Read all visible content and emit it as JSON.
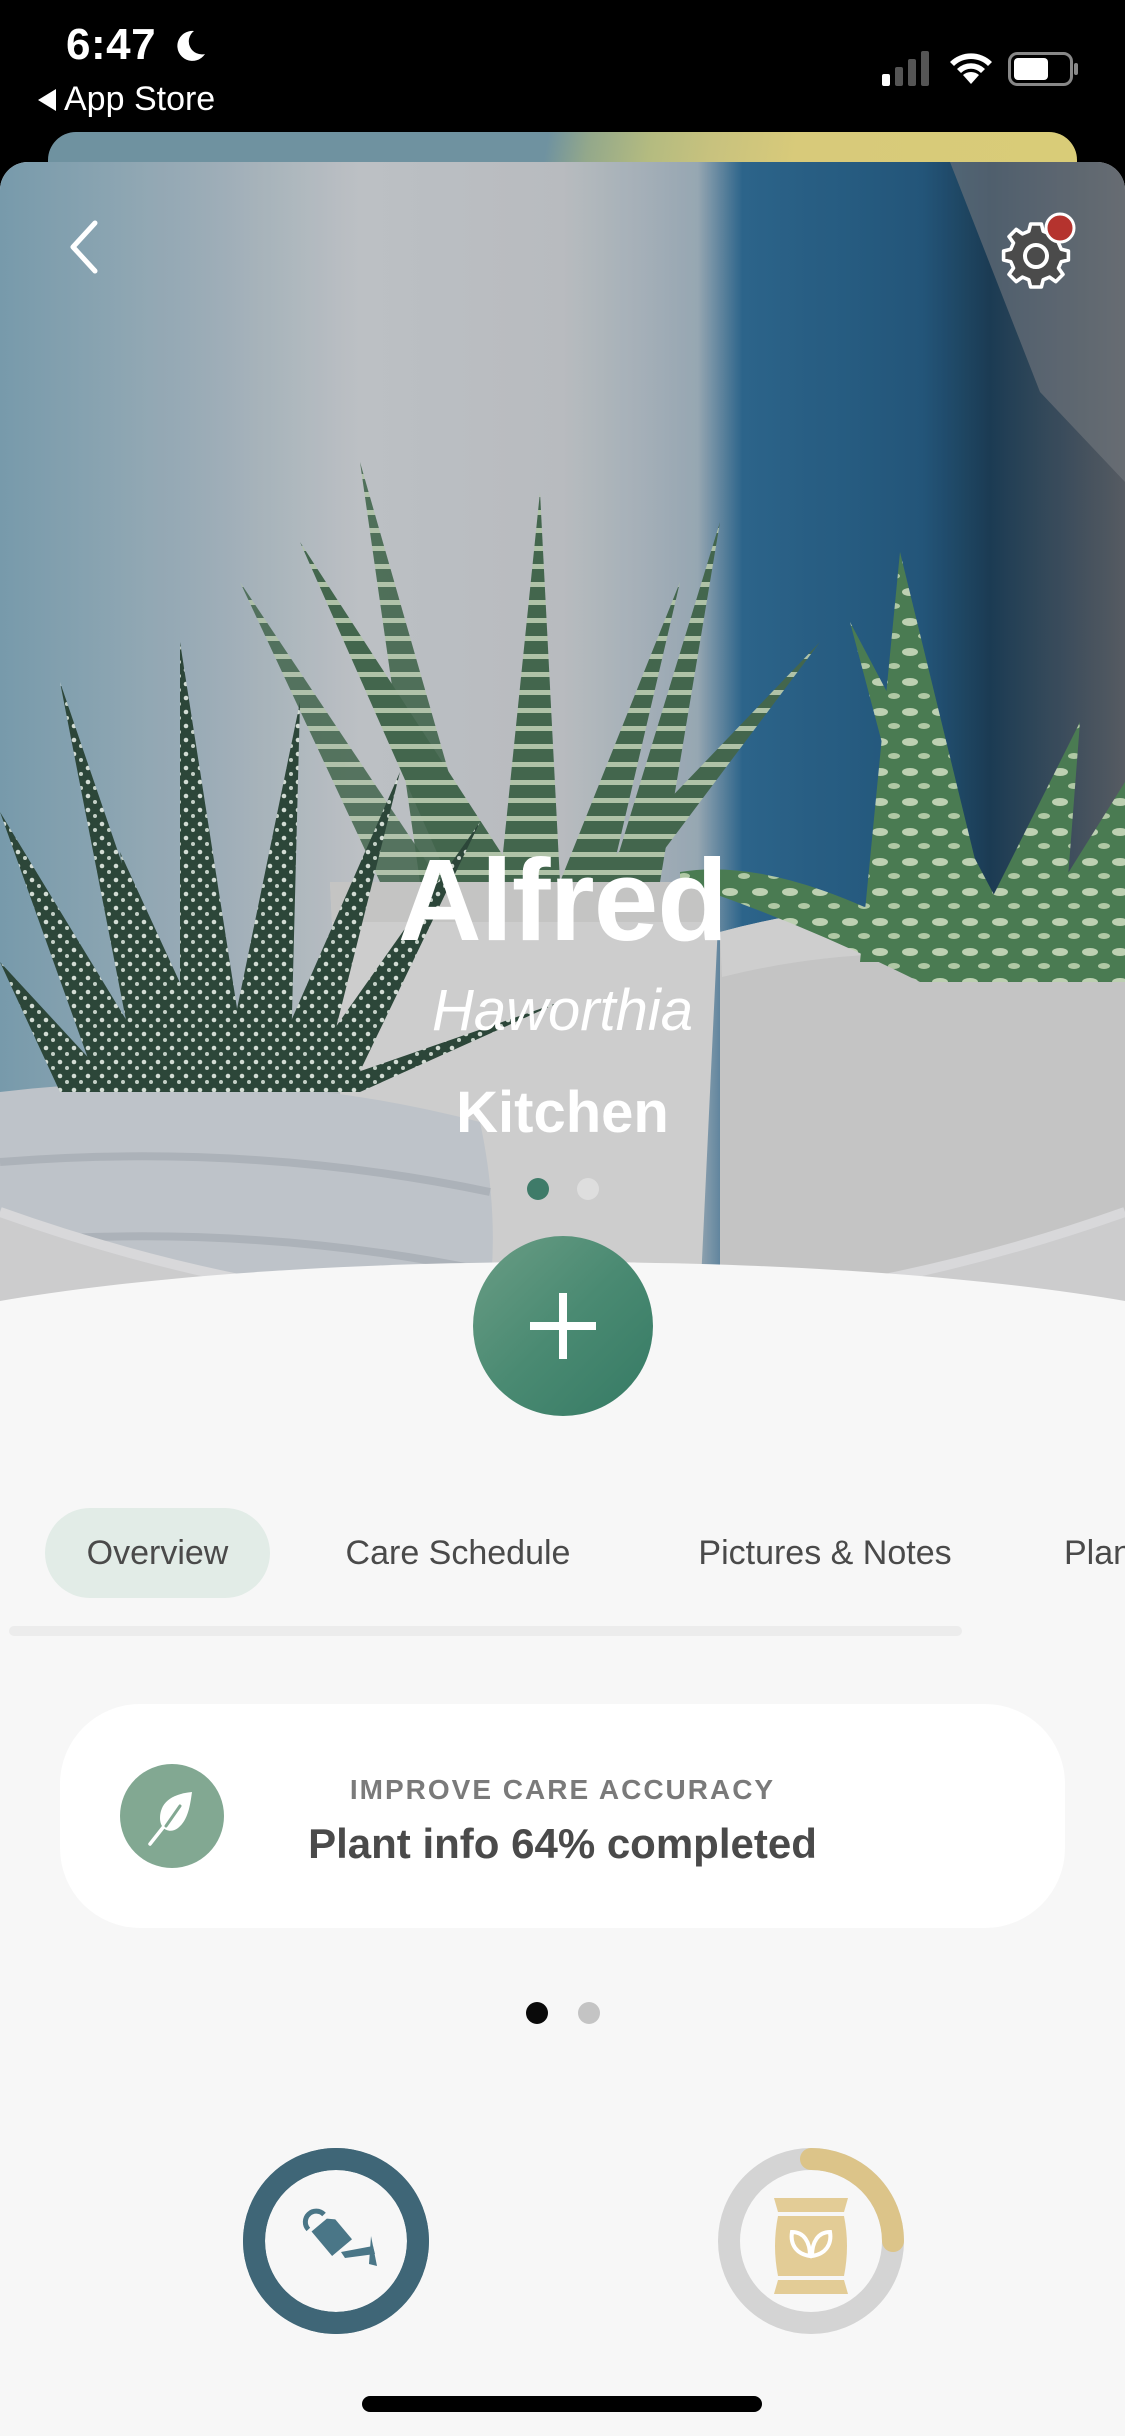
{
  "status_bar": {
    "time": "6:47",
    "focus_icon": "moon-icon",
    "back_app_label": "App Store",
    "signal_bars_active": 1,
    "signal_bars_total": 4,
    "battery_level_percent": 60
  },
  "header": {
    "back_icon": "chevron-left-icon",
    "settings_icon": "gear-icon",
    "settings_has_notification": true,
    "notification_color": "#b5332e"
  },
  "plant": {
    "name": "Alfred",
    "species": "Haworthia",
    "room": "Kitchen"
  },
  "hero_carousel": {
    "page_count": 2,
    "active_index": 0
  },
  "add_button": {
    "icon": "plus-icon",
    "color": "#4a8a72"
  },
  "tabs": [
    {
      "label": "Overview",
      "active": true
    },
    {
      "label": "Care Schedule",
      "active": false
    },
    {
      "label": "Pictures & Notes",
      "active": false
    },
    {
      "label": "Plant Info",
      "active": false
    }
  ],
  "care_card": {
    "icon": "leaf-icon",
    "kicker": "IMPROVE CARE ACCURACY",
    "headline": "Plant info 64% completed",
    "completion_percent": 64
  },
  "card_carousel": {
    "page_count": 2,
    "active_index": 0
  },
  "care_rings": [
    {
      "type": "watering",
      "icon": "watering-can-icon",
      "progress": 1.0,
      "color": "#3f6677",
      "track_color": "#3f6677"
    },
    {
      "type": "fertilizing",
      "icon": "fertilizer-bag-icon",
      "progress": 0.25,
      "color": "#dcc489",
      "track_color": "#d4d4d4"
    }
  ],
  "colors": {
    "accent_green": "#3f7b69",
    "background": "#f7f7f7",
    "text_dark": "#4a4a4a"
  }
}
